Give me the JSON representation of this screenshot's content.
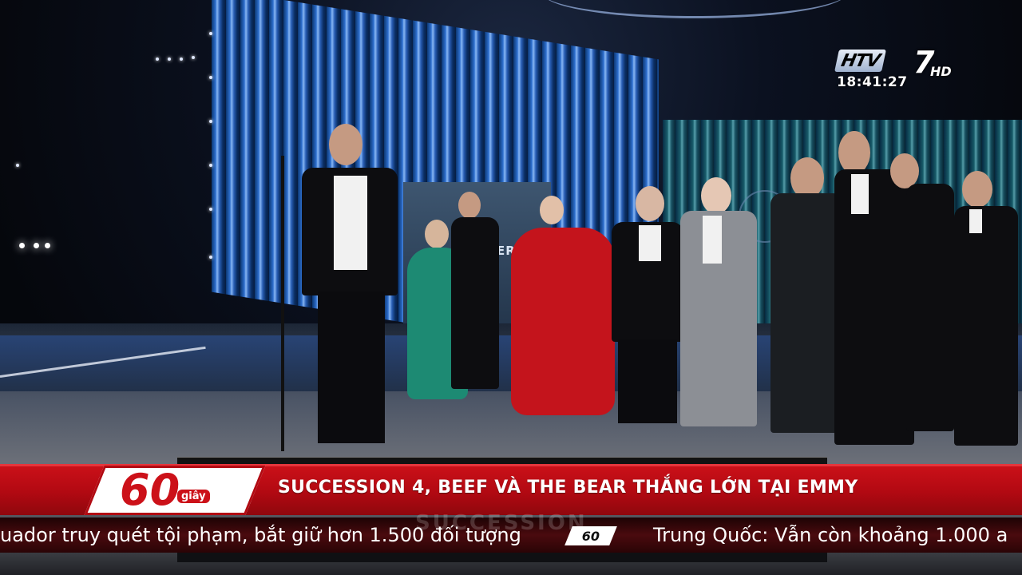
{
  "broadcast": {
    "channel_logo_letters": "HTV",
    "channel_logo_number": "7",
    "channel_logo_hd": "HD",
    "clock": "18:41:27"
  },
  "scene": {
    "background_screen_text": "ERIES",
    "ghost_text": "SUCCESSION"
  },
  "lower_third": {
    "program_badge_number": "60",
    "program_badge_word": "giây",
    "headline": "SUCCESSION 4, BEEF VÀ THE BEAR THẮNG LỚN TẠI EMMY",
    "ticker": [
      "uador truy quét tội phạm, bắt giữ hơn 1.500 đối tượng",
      "Trung Quốc: Vẫn còn khoảng 1.000 a"
    ],
    "ticker_separator": "60"
  },
  "colors": {
    "brand_red": "#cc1119",
    "ticker_dark": "#4a0a0e"
  }
}
